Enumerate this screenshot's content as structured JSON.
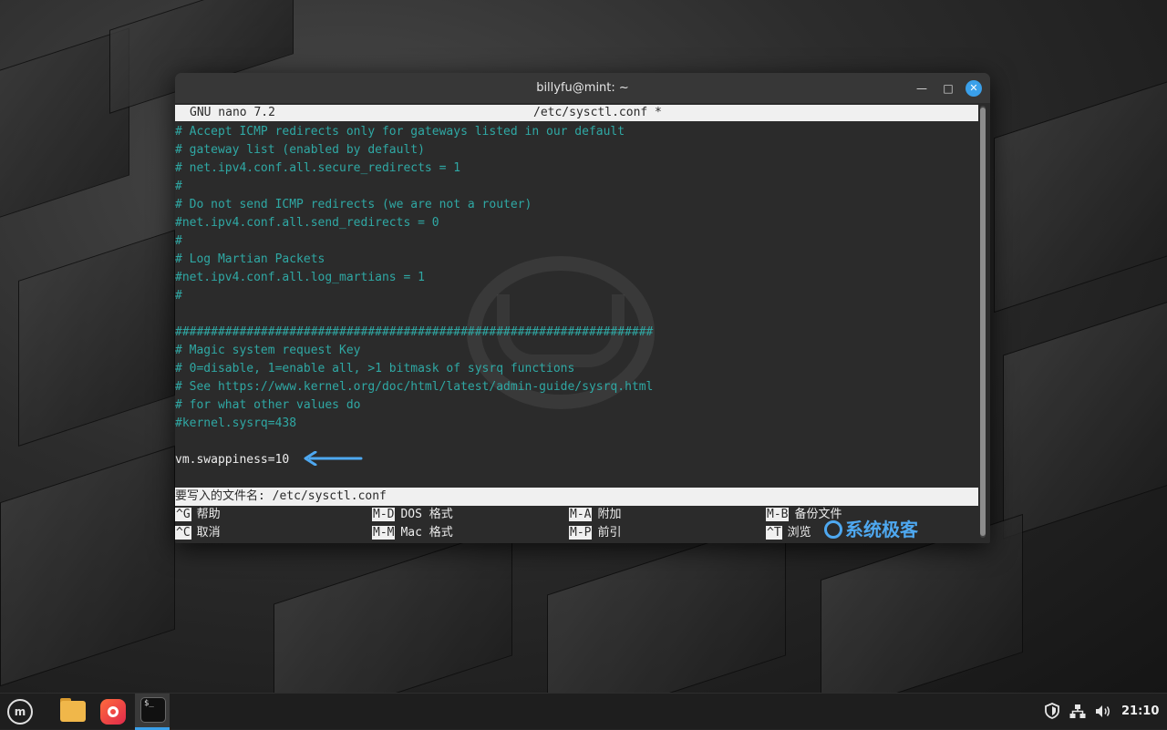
{
  "window": {
    "title": "billyfu@mint: ~",
    "minimize_glyph": "—",
    "maximize_glyph": "□",
    "close_glyph": "✕"
  },
  "nano": {
    "version": "GNU nano 7.2",
    "filename": "/etc/sysctl.conf *",
    "lines": [
      "# Accept ICMP redirects only for gateways listed in our default",
      "# gateway list (enabled by default)",
      "# net.ipv4.conf.all.secure_redirects = 1",
      "#",
      "# Do not send ICMP redirects (we are not a router)",
      "#net.ipv4.conf.all.send_redirects = 0",
      "#",
      "# Log Martian Packets",
      "#net.ipv4.conf.all.log_martians = 1",
      "#",
      "",
      "###################################################################",
      "# Magic system request Key",
      "# 0=disable, 1=enable all, >1 bitmask of sysrq functions",
      "# See https://www.kernel.org/doc/html/latest/admin-guide/sysrq.html",
      "# for what other values do",
      "#kernel.sysrq=438",
      "",
      "vm.swappiness=10"
    ],
    "prompt": "要写入的文件名: /etc/sysctl.conf",
    "shortcuts": [
      {
        "key": "^G",
        "label": "帮助"
      },
      {
        "key": "M-D",
        "label": "DOS 格式"
      },
      {
        "key": "M-A",
        "label": "附加"
      },
      {
        "key": "M-B",
        "label": "备份文件"
      },
      {
        "key": "^C",
        "label": "取消"
      },
      {
        "key": "M-M",
        "label": "Mac 格式"
      },
      {
        "key": "M-P",
        "label": "前引"
      },
      {
        "key": "^T",
        "label": "浏览"
      }
    ]
  },
  "watermark": {
    "text": "系统极客"
  },
  "taskbar": {
    "menu_label": "m",
    "terminal_icon_text": "$_",
    "clock": "21:10",
    "tray_icons": [
      "shield-icon",
      "network-icon",
      "volume-icon"
    ]
  },
  "colors": {
    "comment": "#2fa8a4",
    "accent": "#3aa0ea",
    "arrow": "#4ea8f0"
  }
}
